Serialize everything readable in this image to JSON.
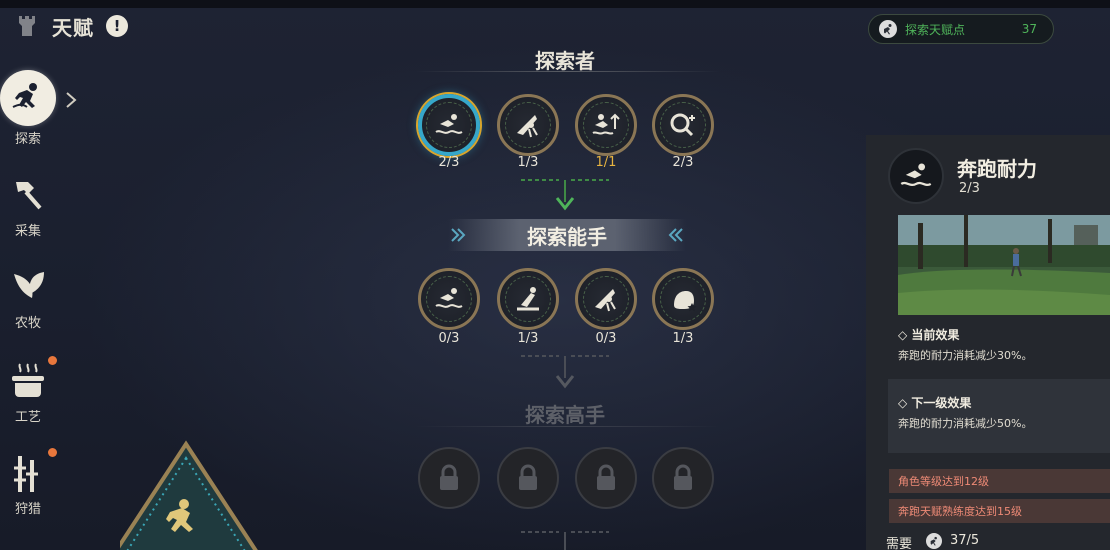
{
  "header": {
    "title": "天赋",
    "info_symbol": "!"
  },
  "nav": {
    "items": [
      {
        "label": "探索",
        "icon": "explorer-runner-icon",
        "active": true,
        "alert": false
      },
      {
        "label": "采集",
        "icon": "axe-icon",
        "active": false,
        "alert": false
      },
      {
        "label": "农牧",
        "icon": "leaf-icon",
        "active": false,
        "alert": false
      },
      {
        "label": "工艺",
        "icon": "cooking-pot-icon",
        "active": false,
        "alert": true
      },
      {
        "label": "狩猎",
        "icon": "hunting-tools-icon",
        "active": false,
        "alert": true
      }
    ]
  },
  "tree": {
    "tiers": [
      {
        "title": "探索者",
        "nodes": [
          {
            "level": "2/3",
            "icon": "swim-stamina-icon",
            "state": "selected"
          },
          {
            "level": "1/3",
            "icon": "glide-icon",
            "state": "normal"
          },
          {
            "level": "1/1",
            "icon": "swim-up-icon",
            "state": "maxed"
          },
          {
            "level": "2/3",
            "icon": "search-plus-icon",
            "state": "normal"
          }
        ]
      },
      {
        "title": "探索能手",
        "nodes": [
          {
            "level": "0/3",
            "icon": "swim-stamina-icon",
            "state": "normal"
          },
          {
            "level": "1/3",
            "icon": "climb-icon",
            "state": "normal"
          },
          {
            "level": "0/3",
            "icon": "glide-icon",
            "state": "normal"
          },
          {
            "level": "1/3",
            "icon": "creature-star-icon",
            "state": "normal"
          }
        ]
      },
      {
        "title": "探索高手",
        "nodes": [
          {
            "level": "",
            "icon": "lock-icon",
            "state": "locked"
          },
          {
            "level": "",
            "icon": "lock-icon",
            "state": "locked"
          },
          {
            "level": "",
            "icon": "lock-icon",
            "state": "locked"
          },
          {
            "level": "",
            "icon": "lock-icon",
            "state": "locked"
          }
        ]
      }
    ]
  },
  "points": {
    "label": "探索天赋点",
    "value": "37"
  },
  "detail": {
    "name": "奔跑耐力",
    "level": "2/3",
    "current_title": "◇ 当前效果",
    "current_text": "奔跑的耐力消耗减少30%。",
    "next_title": "◇ 下一级效果",
    "next_text": "奔跑的耐力消耗减少50%。",
    "requirements": [
      "角色等级达到12级",
      "奔跑天赋熟练度达到15级"
    ],
    "need_label": "需要",
    "need_value": "37/5"
  },
  "colors": {
    "accent_green": "#4fb45a",
    "gold": "#e7b440",
    "selected_ring": "#36a7c9",
    "requirement_red": "#ee8a76",
    "alert_dot": "#e8773c"
  }
}
